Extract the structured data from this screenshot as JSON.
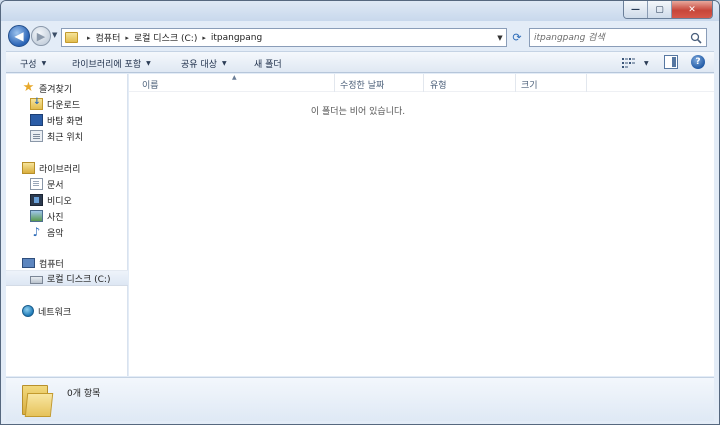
{
  "window": {
    "caption_buttons": {
      "minimize": "—",
      "maximize": "▢",
      "close": "✕"
    }
  },
  "address": {
    "crumbs": [
      "컴퓨터",
      "로컬 디스크 (C:)",
      "itpangpang"
    ],
    "separator": "▸"
  },
  "search": {
    "placeholder": "itpangpang 검색"
  },
  "toolbar": {
    "organize_label": "구성",
    "include_in_library_label": "라이브러리에 포함",
    "share_with_label": "공유 대상",
    "new_folder_label": "새 폴더"
  },
  "sidebar": {
    "favorites": {
      "label": "즐겨찾기",
      "items": [
        {
          "label": "다운로드",
          "icon": "download-folder-icon"
        },
        {
          "label": "바탕 화면",
          "icon": "desktop-icon"
        },
        {
          "label": "최근 위치",
          "icon": "recent-places-icon"
        }
      ]
    },
    "libraries": {
      "label": "라이브러리",
      "items": [
        {
          "label": "문서",
          "icon": "document-icon"
        },
        {
          "label": "비디오",
          "icon": "video-icon"
        },
        {
          "label": "사진",
          "icon": "picture-icon"
        },
        {
          "label": "음악",
          "icon": "music-icon"
        }
      ]
    },
    "computer": {
      "label": "컴퓨터",
      "items": [
        {
          "label": "로컬 디스크 (C:)",
          "icon": "drive-icon",
          "selected": true
        }
      ]
    },
    "network": {
      "label": "네트워크"
    }
  },
  "columns": [
    "이름",
    "수정한 날짜",
    "유형",
    "크기"
  ],
  "content": {
    "empty_message": "이 폴더는 비어 있습니다."
  },
  "details": {
    "item_count": "0개 항목"
  },
  "colors": {
    "window_frame": "#e3ecf7",
    "command_bar": "#dfe8f3",
    "accent_blue": "#2c6bb8"
  }
}
